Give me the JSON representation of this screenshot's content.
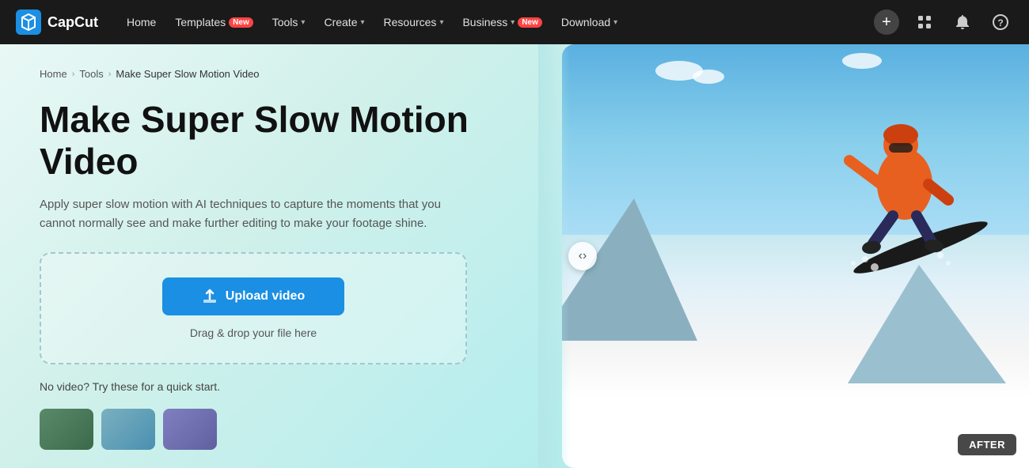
{
  "navbar": {
    "logo_text": "CapCut",
    "items": [
      {
        "id": "home",
        "label": "Home",
        "has_dropdown": false,
        "badge": null
      },
      {
        "id": "templates",
        "label": "Templates",
        "has_dropdown": false,
        "badge": "New"
      },
      {
        "id": "tools",
        "label": "Tools",
        "has_dropdown": true,
        "badge": null
      },
      {
        "id": "create",
        "label": "Create",
        "has_dropdown": true,
        "badge": null
      },
      {
        "id": "resources",
        "label": "Resources",
        "has_dropdown": true,
        "badge": null
      },
      {
        "id": "business",
        "label": "Business",
        "has_dropdown": true,
        "badge": "New"
      },
      {
        "id": "download",
        "label": "Download",
        "has_dropdown": true,
        "badge": null
      }
    ],
    "icons": {
      "plus": "+",
      "grid": "⊞",
      "bell": "🔔",
      "help": "?"
    }
  },
  "breadcrumb": {
    "items": [
      "Home",
      "Tools",
      "Make Super Slow Motion Video"
    ],
    "separator": "›"
  },
  "hero": {
    "title_line1": "Make Super Slow Motion",
    "title_line2": "Video",
    "description": "Apply super slow motion with AI techniques to capture the moments that you cannot normally see and make further editing to make your footage shine.",
    "upload_button_label": "Upload video",
    "upload_hint": "Drag & drop your file here",
    "quick_start_label": "No video? Try these for a quick start.",
    "after_badge": "AFTER"
  },
  "colors": {
    "accent_blue": "#1a8fe3",
    "navbar_bg": "#1a1a1a",
    "badge_red": "#ff4444"
  }
}
